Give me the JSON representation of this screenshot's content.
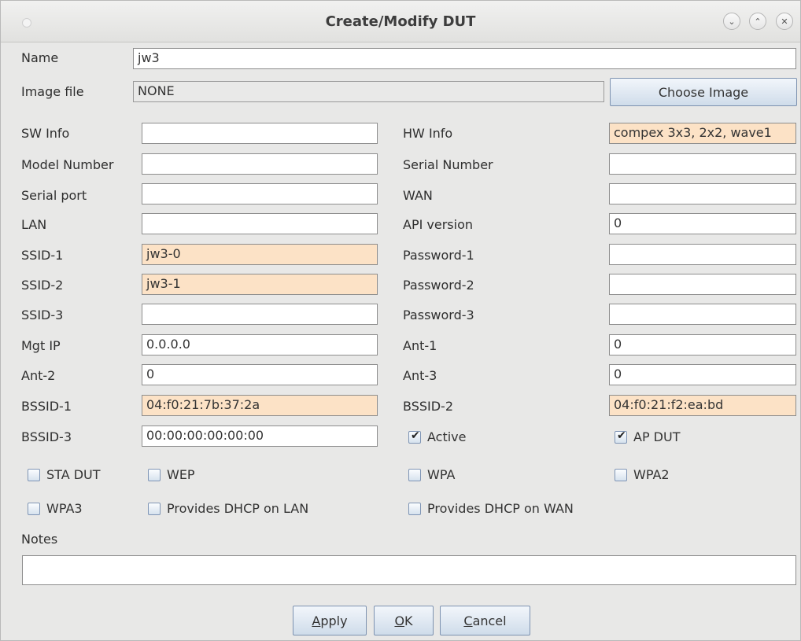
{
  "window": {
    "title": "Create/Modify DUT"
  },
  "name": {
    "label": "Name",
    "value": "jw3"
  },
  "image": {
    "label": "Image file",
    "value": "NONE",
    "button": "Choose Image"
  },
  "left_fields": [
    {
      "label": "SW Info",
      "value": ""
    },
    {
      "label": "Model Number",
      "value": ""
    },
    {
      "label": "Serial port",
      "value": ""
    },
    {
      "label": "LAN",
      "value": ""
    },
    {
      "label": "SSID-1",
      "value": "jw3-0"
    },
    {
      "label": "SSID-2",
      "value": "jw3-1"
    },
    {
      "label": "SSID-3",
      "value": ""
    },
    {
      "label": "Mgt IP",
      "value": "0.0.0.0"
    },
    {
      "label": "Ant-2",
      "value": "0"
    },
    {
      "label": "BSSID-1",
      "value": "04:f0:21:7b:37:2a"
    },
    {
      "label": "BSSID-3",
      "value": "00:00:00:00:00:00"
    }
  ],
  "right_fields": [
    {
      "label": "HW Info",
      "value": "compex 3x3, 2x2, wave1"
    },
    {
      "label": "Serial Number",
      "value": ""
    },
    {
      "label": "WAN",
      "value": ""
    },
    {
      "label": "API version",
      "value": "0"
    },
    {
      "label": "Password-1",
      "value": ""
    },
    {
      "label": "Password-2",
      "value": ""
    },
    {
      "label": "Password-3",
      "value": ""
    },
    {
      "label": "Ant-1",
      "value": "0"
    },
    {
      "label": "Ant-3",
      "value": "0"
    },
    {
      "label": "BSSID-2",
      "value": "04:f0:21:f2:ea:bd"
    }
  ],
  "checkboxes": {
    "active": {
      "label": "Active",
      "checked": true
    },
    "ap_dut": {
      "label": "AP DUT",
      "checked": true
    },
    "sta_dut": {
      "label": "STA DUT",
      "checked": false
    },
    "wep": {
      "label": "WEP",
      "checked": false
    },
    "wpa": {
      "label": "WPA",
      "checked": false
    },
    "wpa2": {
      "label": "WPA2",
      "checked": false
    },
    "wpa3": {
      "label": "WPA3",
      "checked": false
    },
    "dhcp_lan": {
      "label": "Provides DHCP on LAN",
      "checked": false
    },
    "dhcp_wan": {
      "label": "Provides DHCP on WAN",
      "checked": false
    }
  },
  "notes": {
    "label": "Notes",
    "value": ""
  },
  "buttons": {
    "apply": {
      "mnemonic": "A",
      "rest": "pply"
    },
    "ok": {
      "mnemonic": "O",
      "rest": "K"
    },
    "cancel": {
      "mnemonic": "C",
      "rest": "ancel"
    }
  },
  "colors": {
    "highlight_field": "#fce2c6",
    "window_bg": "#e8e8e7"
  }
}
